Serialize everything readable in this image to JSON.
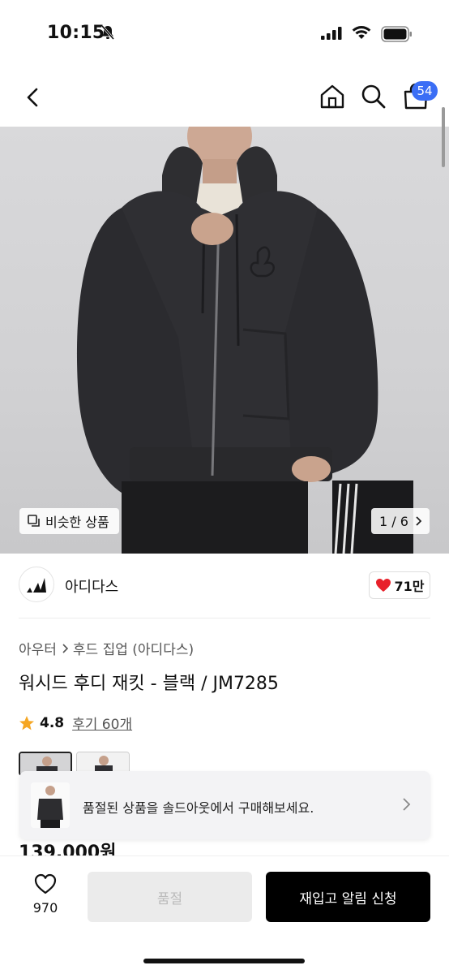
{
  "status": {
    "time": "10:15"
  },
  "nav": {
    "cart_count": "54"
  },
  "hero": {
    "similar_label": "비슷한 상품",
    "page_indicator": "1 / 6"
  },
  "brand": {
    "name": "아디다스",
    "likes": "71만"
  },
  "product": {
    "breadcrumb": [
      "아우터",
      "후드 집업 (아디다스)"
    ],
    "title": "워시드 후디 재킷 - 블랙 / JM7285",
    "rating": "4.8",
    "review_label": "후기 60개",
    "price": "139,000원"
  },
  "soldout_banner": {
    "text": "품절된 상품을 솔드아웃에서 구매해보세요."
  },
  "bottom": {
    "wish_count": "970",
    "soldout_label": "품절",
    "restock_label": "재입고 알림 신청"
  },
  "colors": {
    "accent_blue": "#3b6ef5",
    "heart_red": "#e8202a",
    "star": "#f5a623"
  }
}
